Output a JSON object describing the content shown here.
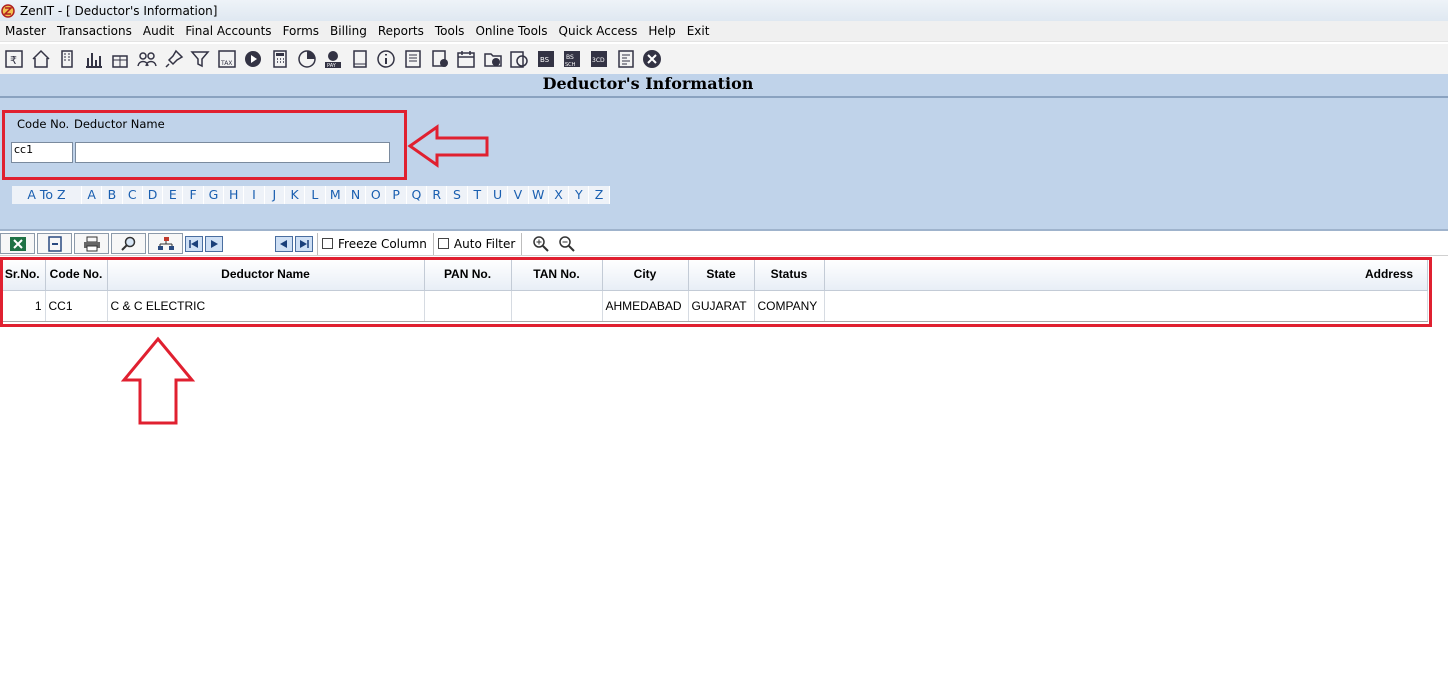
{
  "window": {
    "title": "ZenIT - [ Deductor's Information]"
  },
  "menu": [
    "Master",
    "Transactions",
    "Audit",
    "Final Accounts",
    "Forms",
    "Billing",
    "Reports",
    "Tools",
    "Online Tools",
    "Quick Access",
    "Help",
    "Exit"
  ],
  "toolbar_icons": [
    "rupee-book-icon",
    "home-icon",
    "building-icon",
    "bar-chart-icon",
    "gift-icon",
    "users-icon",
    "pin-icon",
    "filter-icon",
    "tax-icon",
    "play-icon",
    "calculator-icon",
    "pie-chart-icon",
    "pay-icon",
    "book-icon",
    "info-icon",
    "ledger-icon",
    "contact-icon",
    "calendar-icon",
    "folder-add-icon",
    "refresh-icon",
    "bs-icon",
    "bs-sch-icon",
    "3cd-icon",
    "sheet-icon",
    "close-circle-icon"
  ],
  "page": {
    "title": "Deductor's Information"
  },
  "filter": {
    "code_label": "Code No.",
    "name_label": "Deductor Name",
    "code_value": "cc1",
    "name_value": ""
  },
  "alphabet": [
    "A To Z",
    "A",
    "B",
    "C",
    "D",
    "E",
    "F",
    "G",
    "H",
    "I",
    "J",
    "K",
    "L",
    "M",
    "N",
    "O",
    "P",
    "Q",
    "R",
    "S",
    "T",
    "U",
    "V",
    "W",
    "X",
    "Y",
    "Z"
  ],
  "grid_toolbar": {
    "freeze_column": "Freeze Column",
    "auto_filter": "Auto Filter"
  },
  "table": {
    "columns": [
      "Sr.No.",
      "Code No.",
      "Deductor Name",
      "PAN No.",
      "TAN No.",
      "City",
      "State",
      "Status",
      "Address"
    ],
    "rows": [
      [
        "1",
        "CC1",
        "C & C ELECTRIC",
        "",
        "",
        "AHMEDABAD",
        "GUJARAT",
        "COMPANY",
        ""
      ]
    ]
  },
  "colors": {
    "highlight": "#e02030",
    "header_band": "#c0d3ea",
    "alpha_link": "#1a5fb0"
  }
}
